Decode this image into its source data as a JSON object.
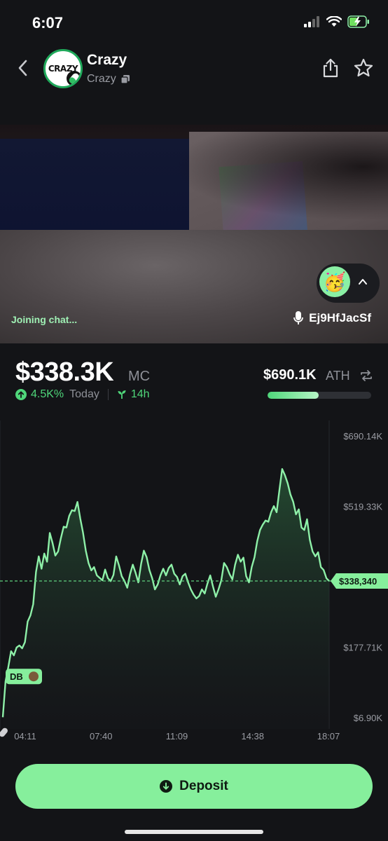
{
  "status_bar": {
    "time": "6:07"
  },
  "header": {
    "avatar_text": "CRAZY",
    "title": "Crazy",
    "subtitle": "Crazy",
    "icons": [
      "back-chevron-icon",
      "share-icon",
      "star-icon",
      "copy-icon"
    ]
  },
  "stream": {
    "status_text": "Joining chat...",
    "speaker": "Ej9HfJacSf",
    "reaction_emoji": "🥳"
  },
  "market": {
    "mc_value": "$338.3K",
    "mc_label": "MC",
    "change": "4.5K%",
    "change_period": "Today",
    "age": "14h",
    "ath_value": "$690.1K",
    "ath_label": "ATH",
    "ath_progress": 0.49
  },
  "chart_data": {
    "type": "line",
    "y_tick_labels": [
      "$690.14K",
      "$519.33K",
      "$177.71K",
      "$6.90K"
    ],
    "y_ticks": [
      690.14,
      519.33,
      177.71,
      6.9
    ],
    "x_tick_labels": [
      "04:11",
      "07:40",
      "11:09",
      "14:38",
      "18:07"
    ],
    "current_label": "$338,340",
    "current_value": 338.34,
    "marker_label": "DB",
    "values": [
      8,
      95,
      130,
      168,
      158,
      177,
      182,
      175,
      190,
      240,
      255,
      282,
      360,
      398,
      368,
      405,
      385,
      455,
      430,
      400,
      410,
      442,
      470,
      468,
      496,
      510,
      508,
      530,
      490,
      456,
      412,
      382,
      364,
      372,
      352,
      346,
      340,
      366,
      345,
      338,
      353,
      398,
      376,
      350,
      338,
      322,
      355,
      378,
      358,
      335,
      380,
      412,
      396,
      365,
      345,
      318,
      330,
      352,
      368,
      352,
      370,
      378,
      356,
      348,
      330,
      350,
      356,
      335,
      318,
      305,
      296,
      302,
      318,
      308,
      332,
      352,
      325,
      300,
      318,
      340,
      382,
      372,
      355,
      342,
      378,
      402,
      385,
      395,
      350,
      335,
      372,
      396,
      435,
      462,
      475,
      485,
      482,
      505,
      520,
      505,
      558,
      610,
      595,
      575,
      548,
      530,
      500,
      512,
      468,
      462,
      488,
      438,
      410,
      398,
      408,
      372,
      365,
      345,
      338
    ]
  },
  "actions": {
    "deposit_label": "Deposit"
  },
  "colors": {
    "accent": "#86ef9c",
    "line": "#8ef0a8",
    "background": "#131417"
  }
}
